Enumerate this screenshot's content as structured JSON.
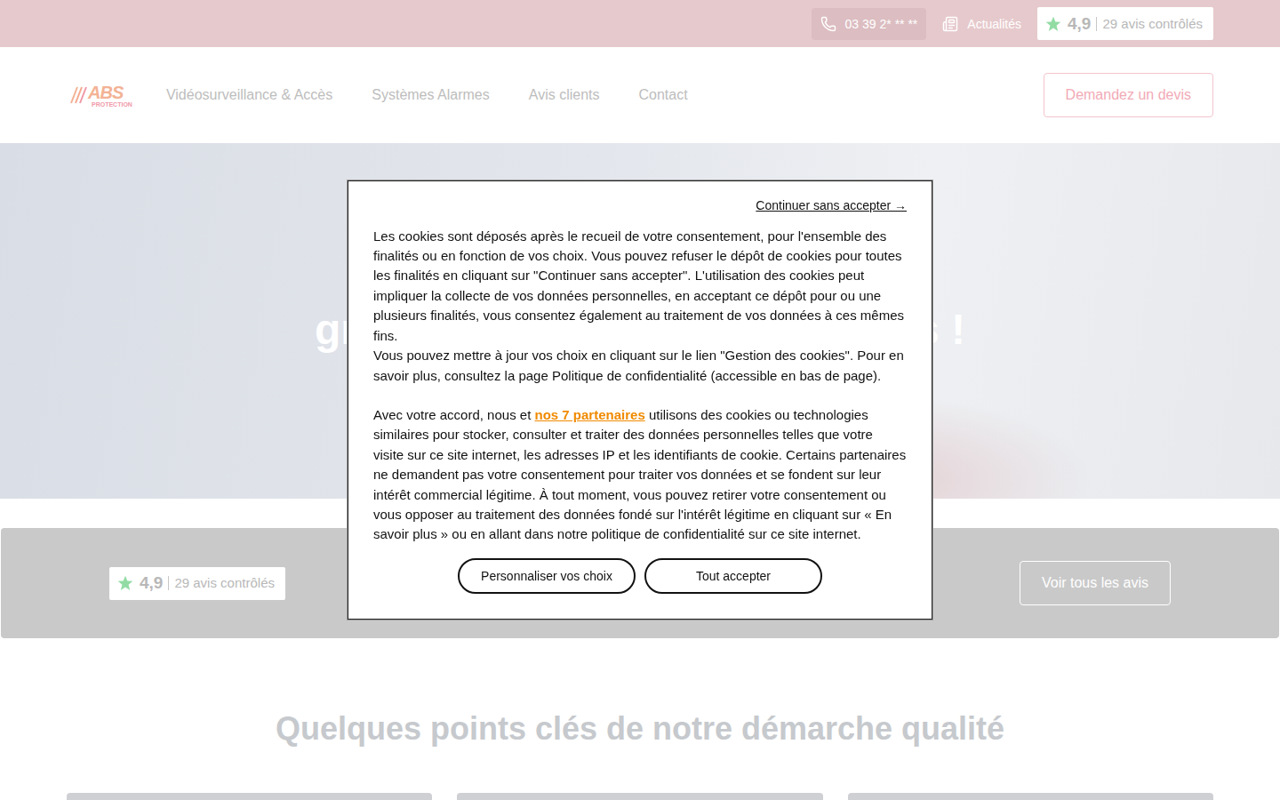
{
  "topbar": {
    "phone": "03 39 2* ** **",
    "news": "Actualités",
    "rating": {
      "score": "4,9",
      "count": "29 avis contrôlés"
    }
  },
  "nav": {
    "logo": {
      "brand": "ABS",
      "sub": "PROTECTION"
    },
    "items": [
      "Vidéosurveillance & Accès",
      "Systèmes Alarmes",
      "Avis clients",
      "Contact"
    ],
    "cta": "Demandez un devis"
  },
  "hero": {
    "title_left": "gr",
    "title_right": "s !"
  },
  "reviews": {
    "rating": {
      "score": "4,9",
      "count": "29 avis contrôlés"
    },
    "button": "Voir tous les avis"
  },
  "section": {
    "title": "Quelques points clés de notre démarche qualité"
  },
  "cookie": {
    "skip": "Continuer sans accepter →",
    "paragraphs": [
      "Les cookies sont déposés après le recueil de votre consentement, pour l'ensemble des finalités ou en fonction de vos choix. Vous pouvez refuser le dépôt de cookies pour toutes les finalités en cliquant sur \"Continuer sans accepter\". L'utilisation des cookies peut impliquer la collecte de vos données personnelles, en acceptant ce dépôt pour ou une plusieurs finalités, vous consentez également au traitement de vos données à ces mêmes fins.",
      "Vous pouvez mettre à jour vos choix en cliquant sur le lien \"Gestion des cookies\". Pour en savoir plus, consultez la page Politique de confidentialité (accessible en bas de page)."
    ],
    "partners_prefix": "Avec votre accord, nous et ",
    "partners_link": "nos 7 partenaires",
    "partners_suffix": " utilisons des cookies ou technologies similaires pour stocker, consulter et traiter des données personnelles telles que votre visite sur ce site internet, les adresses IP et les identifiants de cookie. Certains partenaires ne demandent pas votre consentement pour traiter vos données et se fondent sur leur intérêt commercial légitime. À tout moment, vous pouvez retirer votre consentement ou vous opposer au traitement des données fondé sur l'intérêt légitime en cliquant sur « En savoir plus » ou en allant dans notre politique de confidentialité sur ce site internet.",
    "buttons": [
      "Personnaliser vos choix",
      "Tout accepter"
    ]
  }
}
